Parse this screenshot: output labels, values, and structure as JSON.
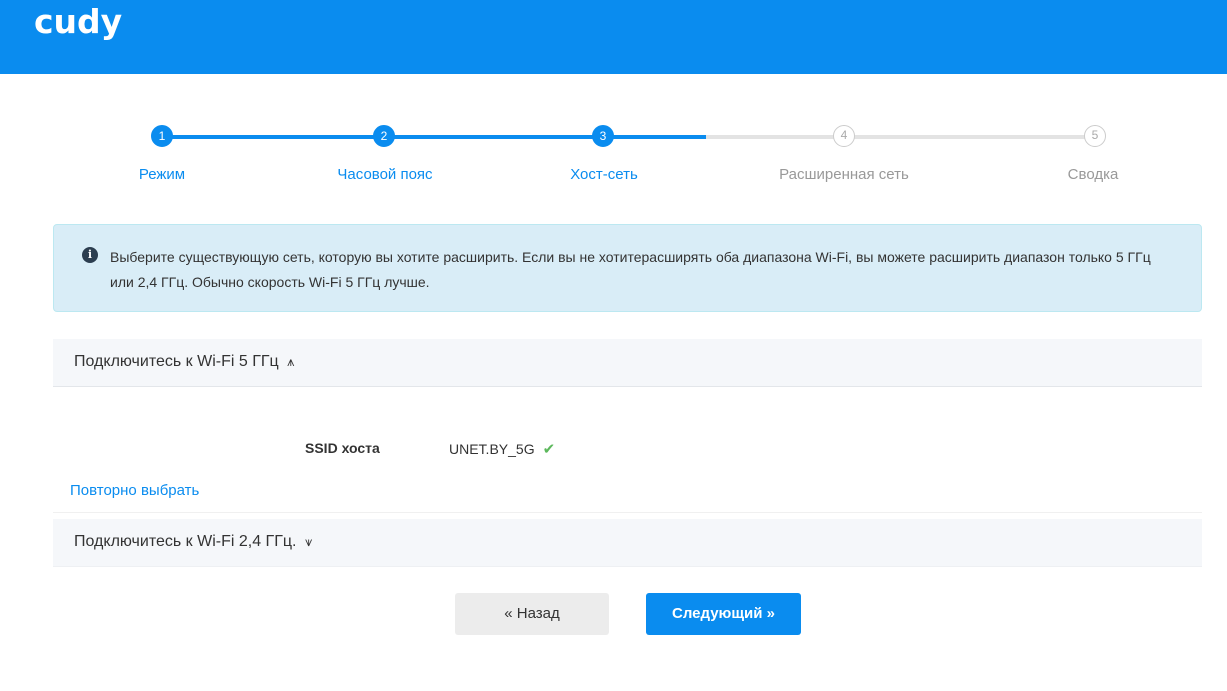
{
  "header": {
    "logo": "cudy"
  },
  "steps": [
    {
      "number": "1",
      "label": "Режим",
      "state": "done"
    },
    {
      "number": "2",
      "label": "Часовой пояс",
      "state": "done"
    },
    {
      "number": "3",
      "label": "Хост-сеть",
      "state": "current"
    },
    {
      "number": "4",
      "label": "Расширенная сеть",
      "state": "pending"
    },
    {
      "number": "5",
      "label": "Сводка",
      "state": "pending"
    }
  ],
  "info": {
    "icon": "info-circle-icon",
    "text": "Выберите существующую сеть, которую вы хотите расширить. Если вы не хотитерасширять оба диапазона Wi-Fi, вы можете расширить диапазон только 5 ГГц или 2,4 ГГц. Обычно скорость Wi-Fi 5 ГГц лучше."
  },
  "section_5g": {
    "title": "Подключитесь к Wi-Fi 5 ГГц",
    "chevron": "≽",
    "ssid_label": "SSID хоста",
    "ssid_value": "UNET.BY_5G",
    "check": "✔",
    "reselect": "Повторно выбрать"
  },
  "section_24g": {
    "title": "Подключитесь к Wi-Fi 2,4 ГГц.",
    "chevron": "≽"
  },
  "buttons": {
    "back": "« Назад",
    "next": "Следующий »"
  },
  "colors": {
    "accent": "#0a8cef",
    "info_bg": "#d9edf7",
    "check": "#5cb85c"
  }
}
